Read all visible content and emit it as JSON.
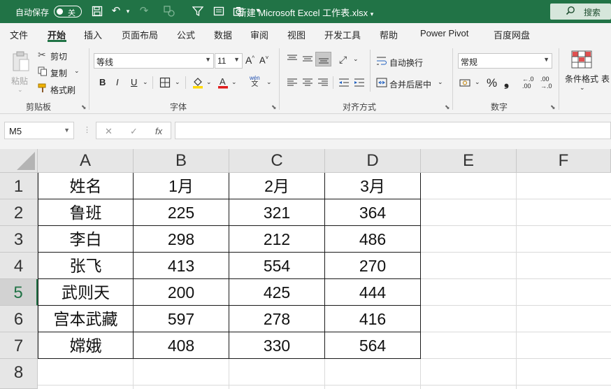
{
  "titlebar": {
    "autosave_label": "自动保存",
    "autosave_state": "关",
    "save_icon": "💾",
    "undo_icon": "↶",
    "redo_icon": "↷",
    "more_icon": "▾",
    "title": "新建 Microsoft Excel 工作表.xlsx",
    "title_menu_icon": "▾",
    "search_label": "搜索",
    "accent_color": "#217346"
  },
  "menu": {
    "tabs": [
      "文件",
      "开始",
      "插入",
      "页面布局",
      "公式",
      "数据",
      "审阅",
      "视图",
      "开发工具",
      "帮助",
      "Power Pivot",
      "百度网盘"
    ],
    "active": "开始"
  },
  "ribbon": {
    "clipboard": {
      "paste": "粘贴",
      "cut": "剪切",
      "copy": "复制",
      "format_painter": "格式刷",
      "group_label": "剪贴板"
    },
    "font": {
      "font_name": "等线",
      "font_size": "11",
      "grow": "A^",
      "shrink": "A˅",
      "bold": "B",
      "italic": "I",
      "underline": "U",
      "phonetic": "wén",
      "phonetic_sub": "文",
      "font_color_letter": "A",
      "group_label": "字体"
    },
    "alignment": {
      "wrap_text": "自动换行",
      "merge_center": "合并后居中",
      "group_label": "对齐方式"
    },
    "number": {
      "format": "常规",
      "percent": "%",
      "comma": "❟",
      "increase_decimal": "←.0 .00",
      "decrease_decimal": ".00 →.0",
      "group_label": "数字"
    },
    "styles": {
      "conditional_format": "条件格式",
      "table_label": "表"
    }
  },
  "formula_bar": {
    "name_box": "M5",
    "cancel": "✕",
    "enter": "✓",
    "fx": "fx",
    "content": ""
  },
  "sheet": {
    "columns": [
      "A",
      "B",
      "C",
      "D",
      "E",
      "F"
    ],
    "rows": [
      "1",
      "2",
      "3",
      "4",
      "5",
      "6",
      "7",
      "8"
    ],
    "selected_row": "5",
    "cells": [
      [
        "姓名",
        "1月",
        "2月",
        "3月"
      ],
      [
        "鲁班",
        "225",
        "321",
        "364"
      ],
      [
        "李白",
        "298",
        "212",
        "486"
      ],
      [
        "张飞",
        "413",
        "554",
        "270"
      ],
      [
        "武则天",
        "200",
        "425",
        "444"
      ],
      [
        "宫本武藏",
        "597",
        "278",
        "416"
      ],
      [
        "嫦娥",
        "408",
        "330",
        "564"
      ]
    ]
  }
}
